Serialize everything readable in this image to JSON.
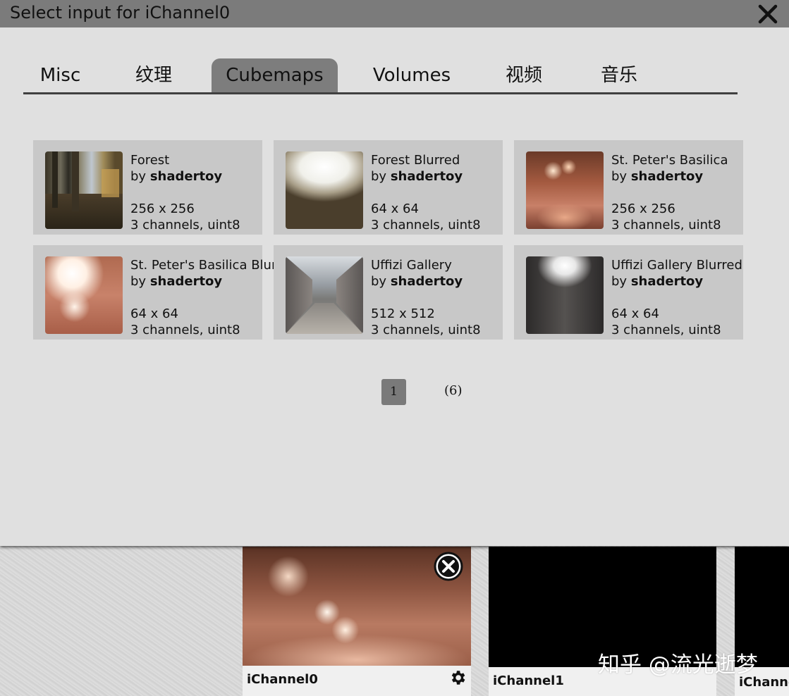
{
  "dialog": {
    "title": "Select input for iChannel0",
    "tabs": [
      {
        "label": "Misc",
        "active": false
      },
      {
        "label": "纹理",
        "active": false
      },
      {
        "label": "Cubemaps",
        "active": true
      },
      {
        "label": "Volumes",
        "active": false
      },
      {
        "label": "视频",
        "active": false
      },
      {
        "label": "音乐",
        "active": false
      }
    ],
    "items": [
      {
        "name": "Forest",
        "by": "by ",
        "author": "shadertoy",
        "size": "256 x 256",
        "format": "3 channels, uint8"
      },
      {
        "name": "Forest Blurred",
        "by": "by ",
        "author": "shadertoy",
        "size": "64 x 64",
        "format": "3 channels, uint8"
      },
      {
        "name": "St. Peter's Basilica",
        "by": "by ",
        "author": "shadertoy",
        "size": "256 x 256",
        "format": "3 channels, uint8"
      },
      {
        "name": "St. Peter's Basilica Blurred",
        "by": "by ",
        "author": "shadertoy",
        "size": "64 x 64",
        "format": "3 channels, uint8"
      },
      {
        "name": "Uffizi Gallery",
        "by": "by ",
        "author": "shadertoy",
        "size": "512 x 512",
        "format": "3 channels, uint8"
      },
      {
        "name": "Uffizi Gallery Blurred",
        "by": "by ",
        "author": "shadertoy",
        "size": "64 x 64",
        "format": "3 channels, uint8"
      }
    ],
    "pagination": {
      "current": "1",
      "count": "(6)"
    }
  },
  "channels": [
    {
      "label": "iChannel0"
    },
    {
      "label": "iChannel1"
    },
    {
      "label": "iChanne"
    }
  ],
  "watermark": "知乎 @流光逝梦",
  "icons": {
    "close": "close-icon",
    "remove": "close-circle-icon",
    "settings": "gear-icon"
  }
}
